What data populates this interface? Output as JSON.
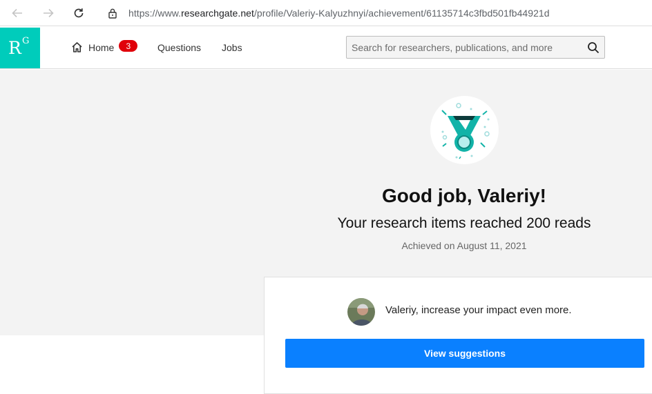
{
  "browser": {
    "url_prefix": "https://www.",
    "url_domain": "researchgate.net",
    "url_path": "/profile/Valeriy-Kalyuzhnyi/achievement/61135714c3fbd501fb44921d"
  },
  "header": {
    "logo_r": "R",
    "logo_g": "G",
    "nav": {
      "home_label": "Home",
      "home_badge": "3",
      "questions_label": "Questions",
      "jobs_label": "Jobs"
    },
    "search": {
      "placeholder": "Search for researchers, publications, and more",
      "value": ""
    }
  },
  "achievement": {
    "headline": "Good job, Valeriy!",
    "message": "Your research items reached 200 reads",
    "date": "Achieved on August 11, 2021"
  },
  "card": {
    "text": "Valeriy, increase your impact even more.",
    "button_label": "View suggestions"
  },
  "colors": {
    "brand": "#00ccbb",
    "badge": "#e0000a",
    "cta": "#0a80ff",
    "medal_teal": "#12b3a8"
  },
  "icons": {
    "back": "arrow-left-icon",
    "forward": "arrow-right-icon",
    "reload": "reload-icon",
    "lock": "lock-icon",
    "home": "home-icon",
    "search": "search-icon",
    "medal": "medal-icon"
  }
}
